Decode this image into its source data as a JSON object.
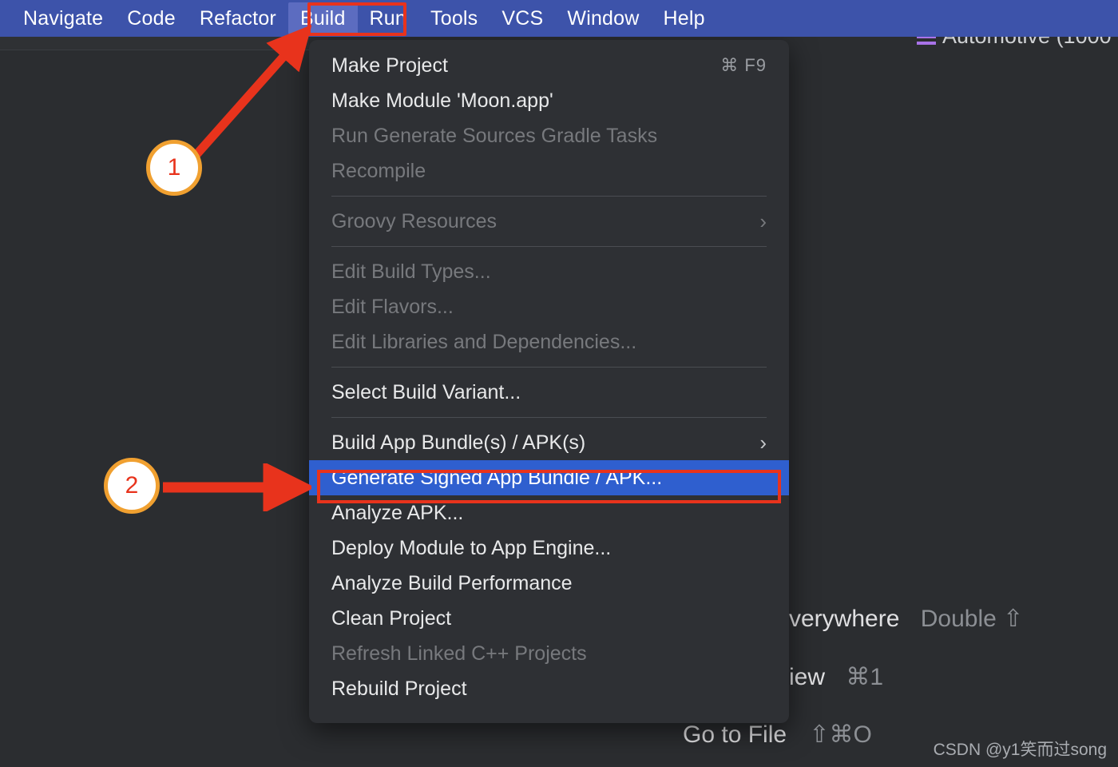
{
  "menubar": {
    "items": [
      {
        "label": "Navigate",
        "active": false
      },
      {
        "label": "Code",
        "active": false
      },
      {
        "label": "Refactor",
        "active": false
      },
      {
        "label": "Build",
        "active": true
      },
      {
        "label": "Run",
        "active": false
      },
      {
        "label": "Tools",
        "active": false
      },
      {
        "label": "VCS",
        "active": false
      },
      {
        "label": "Window",
        "active": false
      },
      {
        "label": "Help",
        "active": false
      }
    ]
  },
  "background": {
    "top_right_partial": "Automotive (1000",
    "rows": [
      {
        "label": "verywhere",
        "accel": "Double ⇧"
      },
      {
        "label": "iew",
        "accel": "⌘1"
      },
      {
        "label": "Go to File",
        "accel": "⇧⌘O"
      }
    ]
  },
  "build_menu": {
    "items": [
      {
        "label": "Make Project",
        "accel": "⌘ F9",
        "state": "enabled",
        "submenu": false
      },
      {
        "label": "Make Module 'Moon.app'",
        "accel": "",
        "state": "enabled",
        "submenu": false
      },
      {
        "label": "Run Generate Sources Gradle Tasks",
        "accel": "",
        "state": "disabled",
        "submenu": false
      },
      {
        "label": "Recompile",
        "accel": "",
        "state": "disabled",
        "submenu": false
      },
      {
        "separator": true
      },
      {
        "label": "Groovy Resources",
        "accel": "",
        "state": "disabled",
        "submenu": true
      },
      {
        "separator": true
      },
      {
        "label": "Edit Build Types...",
        "accel": "",
        "state": "disabled",
        "submenu": false
      },
      {
        "label": "Edit Flavors...",
        "accel": "",
        "state": "disabled",
        "submenu": false
      },
      {
        "label": "Edit Libraries and Dependencies...",
        "accel": "",
        "state": "disabled",
        "submenu": false
      },
      {
        "separator": true
      },
      {
        "label": "Select Build Variant...",
        "accel": "",
        "state": "enabled",
        "submenu": false
      },
      {
        "separator": true
      },
      {
        "label": "Build App Bundle(s) / APK(s)",
        "accel": "",
        "state": "enabled",
        "submenu": true
      },
      {
        "label": "Generate Signed App Bundle / APK...",
        "accel": "",
        "state": "selected",
        "submenu": false
      },
      {
        "label": "Analyze APK...",
        "accel": "",
        "state": "enabled",
        "submenu": false
      },
      {
        "label": "Deploy Module to App Engine...",
        "accel": "",
        "state": "enabled",
        "submenu": false
      },
      {
        "label": "Analyze Build Performance",
        "accel": "",
        "state": "enabled",
        "submenu": false
      },
      {
        "label": "Clean Project",
        "accel": "",
        "state": "enabled",
        "submenu": false
      },
      {
        "label": "Refresh Linked C++ Projects",
        "accel": "",
        "state": "disabled",
        "submenu": false
      },
      {
        "label": "Rebuild Project",
        "accel": "",
        "state": "enabled",
        "submenu": false
      }
    ]
  },
  "annotations": {
    "badges": [
      {
        "number": "1"
      },
      {
        "number": "2"
      }
    ],
    "colors": {
      "arrow": "#e8331c",
      "badge_ring": "#f0a030",
      "badge_text": "#e8331c",
      "selection_blue": "#2f5fcf",
      "menubar_blue": "#3d53aa"
    }
  },
  "watermark": {
    "text": "CSDN @y1笑而过song"
  }
}
